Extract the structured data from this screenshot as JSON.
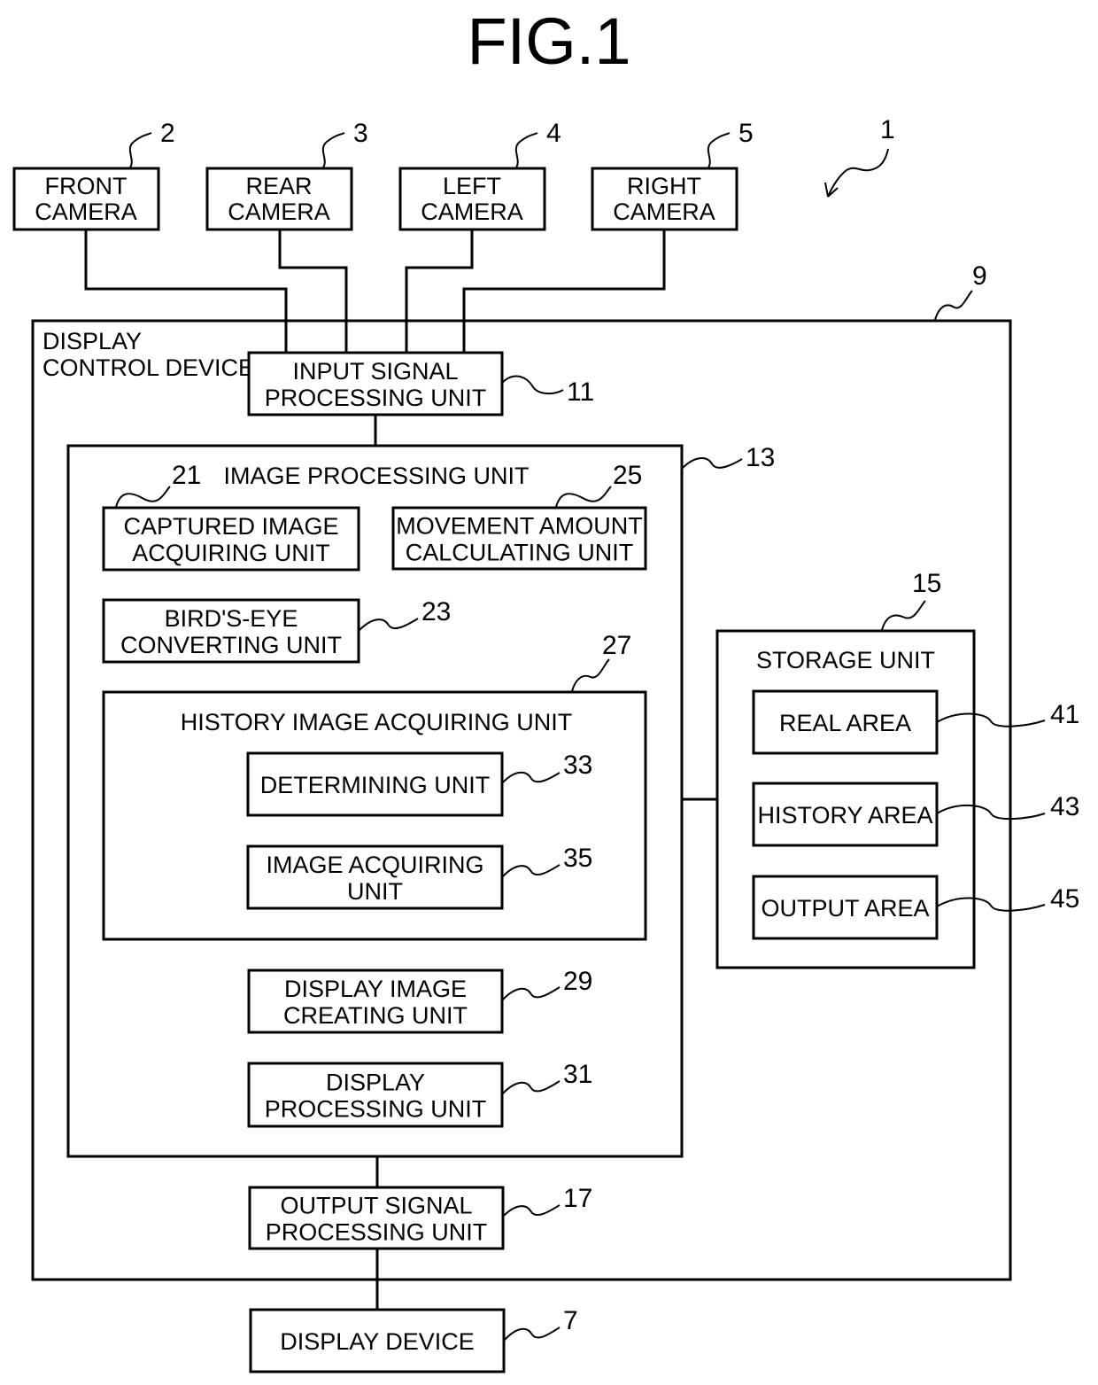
{
  "figure_title": "FIG.1",
  "system_ref": "1",
  "cameras": [
    {
      "ref": "2",
      "lines": [
        "FRONT",
        "CAMERA"
      ]
    },
    {
      "ref": "3",
      "lines": [
        "REAR",
        "CAMERA"
      ]
    },
    {
      "ref": "4",
      "lines": [
        "LEFT",
        "CAMERA"
      ]
    },
    {
      "ref": "5",
      "lines": [
        "RIGHT",
        "CAMERA"
      ]
    }
  ],
  "display_control_device": {
    "ref": "9",
    "lines": [
      "DISPLAY",
      "CONTROL DEVICE"
    ]
  },
  "input_signal_processing_unit": {
    "ref": "11",
    "lines": [
      "INPUT SIGNAL",
      "PROCESSING UNIT"
    ]
  },
  "image_processing_unit": {
    "ref": "13",
    "label": "IMAGE PROCESSING UNIT"
  },
  "captured_image_acquiring_unit": {
    "ref": "21",
    "lines": [
      "CAPTURED IMAGE",
      "ACQUIRING UNIT"
    ]
  },
  "birds_eye_converting_unit": {
    "ref": "23",
    "lines": [
      "BIRD'S-EYE",
      "CONVERTING UNIT"
    ]
  },
  "movement_amount_calculating_unit": {
    "ref": "25",
    "lines": [
      "MOVEMENT AMOUNT",
      "CALCULATING UNIT"
    ]
  },
  "history_image_acquiring_unit": {
    "ref": "27",
    "label": "HISTORY IMAGE ACQUIRING UNIT"
  },
  "determining_unit": {
    "ref": "33",
    "lines": [
      "DETERMINING UNIT"
    ]
  },
  "image_acquiring_unit": {
    "ref": "35",
    "lines": [
      "IMAGE ACQUIRING",
      "UNIT"
    ]
  },
  "display_image_creating_unit": {
    "ref": "29",
    "lines": [
      "DISPLAY IMAGE",
      "CREATING UNIT"
    ]
  },
  "display_processing_unit": {
    "ref": "31",
    "lines": [
      "DISPLAY",
      "PROCESSING UNIT"
    ]
  },
  "storage_unit": {
    "ref": "15",
    "label": "STORAGE UNIT"
  },
  "real_area": {
    "ref": "41",
    "lines": [
      "REAL AREA"
    ]
  },
  "history_area": {
    "ref": "43",
    "lines": [
      "HISTORY AREA"
    ]
  },
  "output_area": {
    "ref": "45",
    "lines": [
      "OUTPUT AREA"
    ]
  },
  "output_signal_processing_unit": {
    "ref": "17",
    "lines": [
      "OUTPUT SIGNAL",
      "PROCESSING UNIT"
    ]
  },
  "display_device": {
    "ref": "7",
    "lines": [
      "DISPLAY DEVICE"
    ]
  }
}
